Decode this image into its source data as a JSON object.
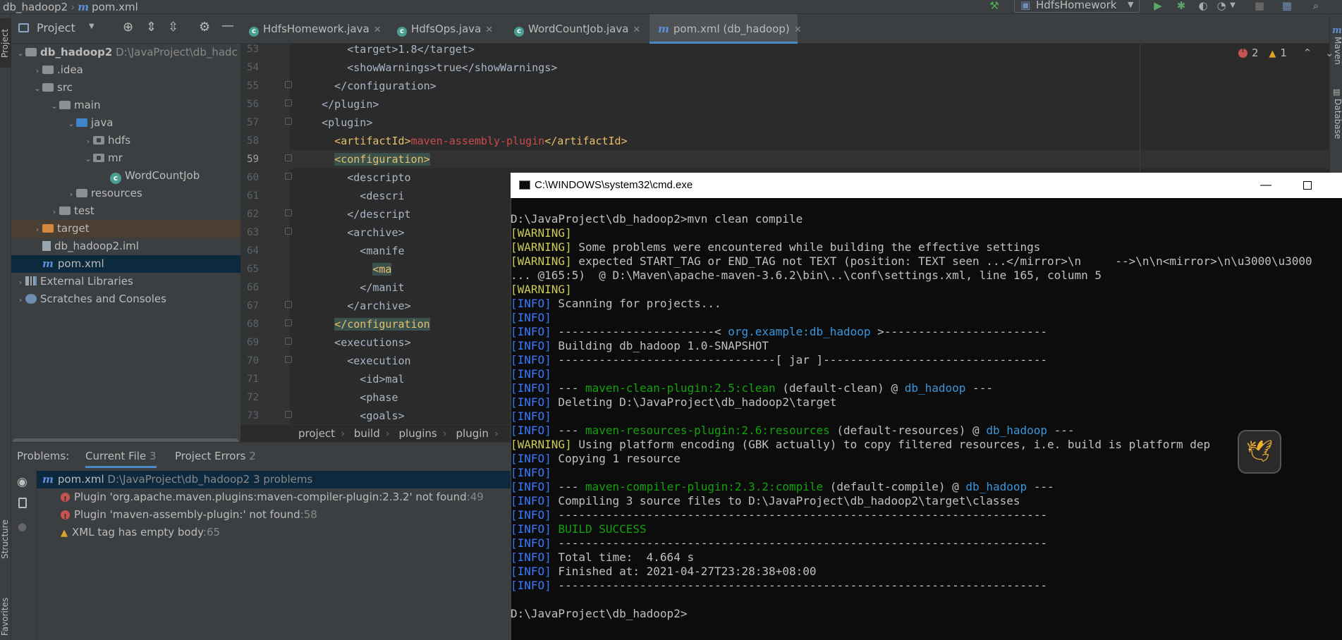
{
  "topbar": {
    "project_name": "db_hadoop2",
    "file_name": "pom.xml",
    "run_config": "HdfsHomework"
  },
  "tool_windows": {
    "project": "Project",
    "structure": "Structure",
    "favorites": "Favorites",
    "maven": "Maven",
    "database": "Database"
  },
  "project_panel": {
    "title": "Project",
    "tree": [
      {
        "label": "db_hadoop2",
        "hint": "D:\\JavaProject\\db_hadc"
      },
      {
        "label": ".idea"
      },
      {
        "label": "src"
      },
      {
        "label": "main"
      },
      {
        "label": "java"
      },
      {
        "label": "hdfs"
      },
      {
        "label": "mr"
      },
      {
        "label": "WordCountJob"
      },
      {
        "label": "resources"
      },
      {
        "label": "test"
      },
      {
        "label": "target"
      },
      {
        "label": "db_hadoop2.iml"
      },
      {
        "label": "pom.xml"
      },
      {
        "label": "External Libraries"
      },
      {
        "label": "Scratches and Consoles"
      }
    ]
  },
  "tabs": [
    {
      "label": "HdfsHomework.java"
    },
    {
      "label": "HdfsOps.java"
    },
    {
      "label": "WordCountJob.java"
    },
    {
      "label": "pom.xml (db_hadoop)"
    }
  ],
  "editor": {
    "inspections": {
      "errors": "2",
      "warnings": "1"
    },
    "lines": [
      {
        "n": "53",
        "text": "        <target>1.8</target>"
      },
      {
        "n": "54",
        "text": "        <showWarnings>true</showWarnings>"
      },
      {
        "n": "55",
        "text": "      </configuration>"
      },
      {
        "n": "56",
        "text": "    </plugin>"
      },
      {
        "n": "57",
        "text": "    <plugin>"
      },
      {
        "n": "58",
        "a": "      <artifactId>",
        "b": "maven-assembly-plugin",
        "c": "</artifactId>"
      },
      {
        "n": "59",
        "text": "<configuration>"
      },
      {
        "n": "60",
        "text": "        <descripto"
      },
      {
        "n": "61",
        "text": "          <descri"
      },
      {
        "n": "62",
        "text": "        </descript"
      },
      {
        "n": "63",
        "text": "        <archive>"
      },
      {
        "n": "64",
        "text": "          <manife"
      },
      {
        "n": "65",
        "text": "<ma"
      },
      {
        "n": "66",
        "text": "          </manit"
      },
      {
        "n": "67",
        "text": "        </archive>"
      },
      {
        "n": "68",
        "text": "</configuration"
      },
      {
        "n": "69",
        "text": "      <executions>"
      },
      {
        "n": "70",
        "text": "        <execution"
      },
      {
        "n": "71",
        "text": "          <id>mal"
      },
      {
        "n": "72",
        "text": "          <phase"
      },
      {
        "n": "73",
        "text": "          <goals>"
      }
    ]
  },
  "breadcrumb": [
    "project",
    "build",
    "plugins",
    "plugin"
  ],
  "problems": {
    "label": "Problems:",
    "current_file": "Current File",
    "current_file_count": "3",
    "project_errors": "Project Errors",
    "project_errors_count": "2",
    "file_row": {
      "name": "pom.xml",
      "path": "D:\\JavaProject\\db_hadoop2",
      "count": "3 problems"
    },
    "items": [
      {
        "text": "Plugin 'org.apache.maven.plugins:maven-compiler-plugin:2.3.2' not found",
        "loc": ":49"
      },
      {
        "text": "Plugin 'maven-assembly-plugin:' not found",
        "loc": ":58"
      },
      {
        "text": "XML tag has empty body",
        "loc": ":65"
      }
    ]
  },
  "cmd": {
    "title": "C:\\WINDOWS\\system32\\cmd.exe",
    "l1": "D:\\JavaProject\\db_hadoop2>mvn clean compile",
    "warn": "[WARNING]",
    "info": "[INFO]",
    "w2": " Some problems were encountered while building the effective settings",
    "w3": " expected START_TAG or END_TAG not TEXT (position: TEXT seen ...</mirror>\\n     -->\\n\\n<mirror>\\n\\u3000\\u3000",
    "l5": "... @165:5)  @ D:\\Maven\\apache-maven-3.6.2\\bin\\..\\conf\\settings.xml, line 165, column 5",
    "scanning": " Scanning for projects...",
    "dash_a": " -----------------------< ",
    "artifact": "org.example:db_hadoop",
    "dash_b": " >------------------------",
    "building": " Building db_hadoop 1.0-SNAPSHOT",
    "jar_line": " --------------------------------[ jar ]---------------------------------",
    "dashes3": " --- ",
    "clean_plugin": "maven-clean-plugin:2.5:clean",
    "clean_rest": " (default-clean) @ ",
    "proj": "db_hadoop",
    "tail": " ---",
    "deleting": " Deleting D:\\JavaProject\\db_hadoop2\\target",
    "res_plugin": "maven-resources-plugin:2.6:resources",
    "res_rest": " (default-resources) @ ",
    "encoding": " Using platform encoding (GBK actually) to copy filtered resources, i.e. build is platform dep",
    "enc_end": "!",
    "copying": " Copying 1 resource",
    "comp_plugin": "maven-compiler-plugin:2.3.2:compile",
    "comp_rest": " (default-compile) @ ",
    "compiling": " Compiling 3 source files to D:\\JavaProject\\db_hadoop2\\target\\classes",
    "long_dash": " ------------------------------------------------------------------------",
    "success": "BUILD SUCCESS",
    "total": " Total time:  4.664 s",
    "finished": " Finished at: 2021-04-27T23:28:38+08:00",
    "prompt": "D:\\JavaProject\\db_hadoop2>"
  },
  "colors": {
    "accent": "#4a88c7",
    "error": "#c75450",
    "warning": "#e0a526",
    "xml_tag": "#e8bf6a",
    "cmd_info": "#3b78ff",
    "cmd_plugin": "#13a10e",
    "cmd_project": "#3a96dd"
  }
}
